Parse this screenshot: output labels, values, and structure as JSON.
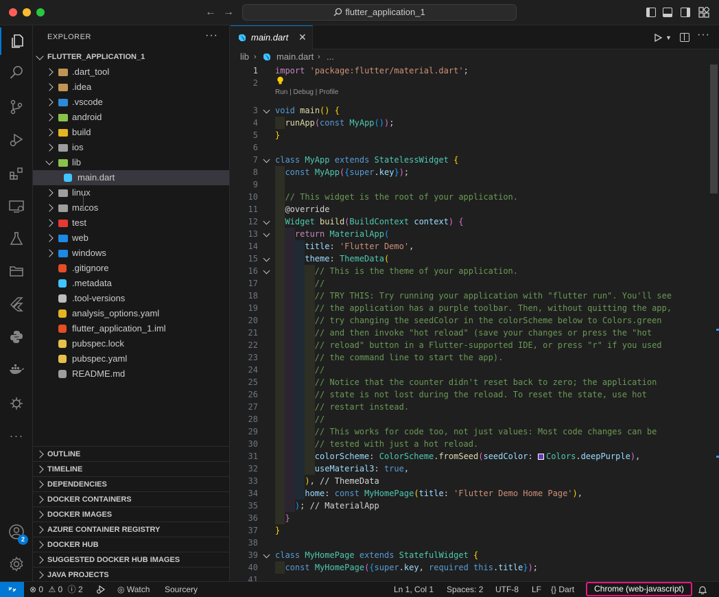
{
  "titlebar": {
    "search": "flutter_application_1"
  },
  "explorer": {
    "title": "EXPLORER",
    "more": "···",
    "root": "FLUTTER_APPLICATION_1",
    "items": [
      {
        "label": ".dart_tool",
        "type": "folder",
        "color": "#c09553"
      },
      {
        "label": ".idea",
        "type": "folder",
        "color": "#c09553"
      },
      {
        "label": ".vscode",
        "type": "folder",
        "color": "#2e8ad6"
      },
      {
        "label": "android",
        "type": "folder",
        "color": "#8bc34a"
      },
      {
        "label": "build",
        "type": "folder",
        "color": "#e6b422"
      },
      {
        "label": "ios",
        "type": "folder",
        "color": "#9e9e9e"
      },
      {
        "label": "lib",
        "type": "folder",
        "color": "#8bc34a"
      },
      {
        "label": "main.dart",
        "type": "file",
        "color": "#40c4ff"
      },
      {
        "label": "linux",
        "type": "folder",
        "color": "#9e9e9e"
      },
      {
        "label": "macos",
        "type": "folder",
        "color": "#9e9e9e"
      },
      {
        "label": "test",
        "type": "folder",
        "color": "#e53935"
      },
      {
        "label": "web",
        "type": "folder",
        "color": "#1e88e5"
      },
      {
        "label": "windows",
        "type": "folder",
        "color": "#1e88e5"
      },
      {
        "label": ".gitignore",
        "type": "file",
        "color": "#e44d26"
      },
      {
        "label": ".metadata",
        "type": "file",
        "color": "#40c4ff"
      },
      {
        "label": ".tool-versions",
        "type": "file",
        "color": "#bdbdbd"
      },
      {
        "label": "analysis_options.yaml",
        "type": "file",
        "color": "#e6b422"
      },
      {
        "label": "flutter_application_1.iml",
        "type": "file",
        "color": "#e44d26"
      },
      {
        "label": "pubspec.lock",
        "type": "file",
        "color": "#e6c04a"
      },
      {
        "label": "pubspec.yaml",
        "type": "file",
        "color": "#e6c04a"
      },
      {
        "label": "README.md",
        "type": "file",
        "color": "#9e9e9e"
      }
    ],
    "sections": [
      "OUTLINE",
      "TIMELINE",
      "DEPENDENCIES",
      "DOCKER CONTAINERS",
      "DOCKER IMAGES",
      "AZURE CONTAINER REGISTRY",
      "DOCKER HUB",
      "SUGGESTED DOCKER HUB IMAGES",
      "JAVA PROJECTS"
    ]
  },
  "activity": {
    "accounts_badge": "2",
    "more": "···"
  },
  "tab": {
    "label": "main.dart",
    "close": "✕"
  },
  "breadcrumb": {
    "folder": "lib",
    "file": "main.dart",
    "more": "..."
  },
  "editor": {
    "codelens": "Run | Debug | Profile"
  },
  "statusbar": {
    "errors": "0",
    "warnings": "0",
    "info": "2",
    "watch": "Watch",
    "sourcery": "Sourcery",
    "position": "Ln 1, Col 1",
    "spaces": "Spaces: 2",
    "encoding": "UTF-8",
    "eol": "LF",
    "language": "Dart",
    "device": "Chrome (web-javascript)"
  },
  "colors": {
    "accent": "#0078d4",
    "highlight": "#e5197f",
    "swatch": "#673ab7"
  }
}
